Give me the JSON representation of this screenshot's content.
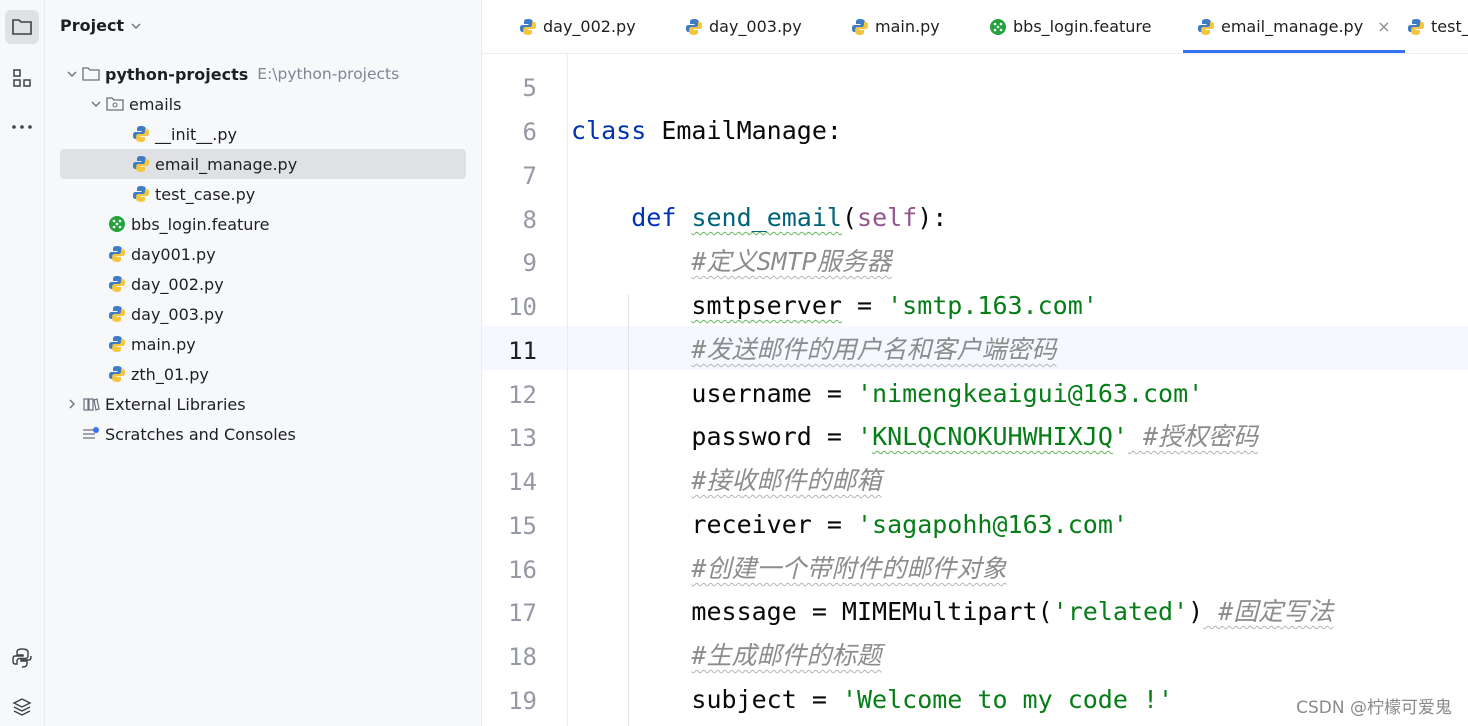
{
  "sidebar": {
    "project_label": "Project"
  },
  "tree": {
    "root": {
      "name": "python-projects",
      "path": "E:\\python-projects"
    },
    "emails": "emails",
    "init": "__init__.py",
    "email_manage": "email_manage.py",
    "test_case": "test_case.py",
    "bbs": "bbs_login.feature",
    "day001": "day001.py",
    "day002": "day_002.py",
    "day003": "day_003.py",
    "main": "main.py",
    "zth": "zth_01.py",
    "ext": "External Libraries",
    "scratch": "Scratches and Consoles"
  },
  "tabs": [
    "day_002.py",
    "day_003.py",
    "main.py",
    "bbs_login.feature",
    "email_manage.py",
    "test_"
  ],
  "tab_close": "×",
  "lines": {
    "n": [
      "5",
      "6",
      "7",
      "8",
      "9",
      "10",
      "11",
      "12",
      "13",
      "14",
      "15",
      "16",
      "17",
      "18",
      "19"
    ],
    "l6_kw": "class",
    "l6_name": " EmailManage:",
    "l8_kw": "def",
    "l8_fn": "send_email",
    "l8_p1": "(",
    "l8_self": "self",
    "l8_p2": "):",
    "l9": "#定义SMTP服务器",
    "l10_var": "smtpserver",
    "l10_eq": " = ",
    "l10_str": "'smtp.163.com'",
    "l11": "#发送邮件的用户名和客户端密码",
    "l12_var": "username = ",
    "l12_str": "'nimengkeaigui@163.com'",
    "l13_var": "password = ",
    "l13_q1": "'",
    "l13_str": "KNLQCNOKUHWHIXJQ",
    "l13_q2": "'",
    "l13_cmt": " #授权密码",
    "l14": "#接收邮件的邮箱",
    "l15_var": "receiver = ",
    "l15_str": "'sagapohh@163.com'",
    "l16": "#创建一个带附件的邮件对象",
    "l17_var": "message = MIMEMultipart(",
    "l17_str": "'related'",
    "l17_close": ")",
    "l17_cmt": " #固定写法",
    "l18": "#生成邮件的标题",
    "l19_var": "subject = ",
    "l19_str": "'Welcome to my code !'"
  },
  "watermark": "CSDN @柠檬可爱鬼",
  "colors": {
    "accent": "#3574f0",
    "keyword": "#0033b3",
    "string": "#067d17",
    "comment": "#8c8c8c"
  },
  "icons": [
    "folder-icon",
    "structure-icon",
    "more-icon",
    "python-console-icon",
    "layers-icon",
    "python-file-icon",
    "cucumber-icon",
    "library-icon",
    "scratches-icon"
  ]
}
